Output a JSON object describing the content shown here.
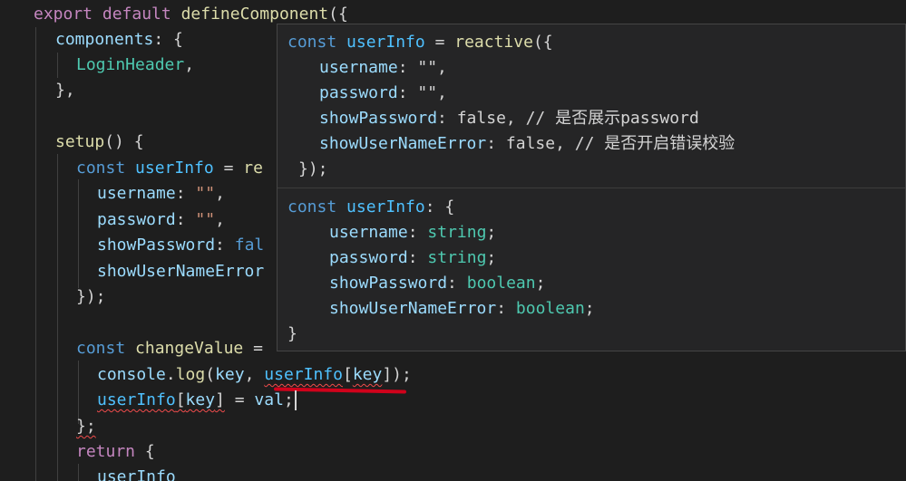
{
  "code": {
    "l1": {
      "kw1": "export",
      "kw2": "default",
      "fn": "defineComponent",
      "rest": "({"
    },
    "l2": {
      "key": "components",
      "rest": ": {"
    },
    "l3": {
      "cls": "LoginHeader",
      "rest": ","
    },
    "l4": {
      "rest": "},"
    },
    "l6": {
      "fn": "setup",
      "rest": "() {"
    },
    "l7": {
      "kw": "const",
      "var": "userInfo",
      "eq": " = ",
      "fn": "re"
    },
    "l8": {
      "key": "username",
      "colon": ": ",
      "str": "\"\"",
      "comma": ","
    },
    "l9": {
      "key": "password",
      "colon": ": ",
      "str": "\"\"",
      "comma": ","
    },
    "l10": {
      "key": "showPassword",
      "colon": ": ",
      "val": "fal"
    },
    "l11": {
      "key": "showUserNameError"
    },
    "l12": {
      "rest": "});"
    },
    "l14": {
      "kw": "const",
      "fn": "changeValue",
      "eq": " ="
    },
    "l15": {
      "obj": "console",
      "dot": ".",
      "fn": "log",
      "open": "(",
      "arg": "key",
      "sep": ", ",
      "var": "userInfo",
      "lb": "[",
      "key": "key",
      "rb": "]",
      "end": ");"
    },
    "l16": {
      "var": "userInfo",
      "lb": "[",
      "key": "key",
      "rb": "]",
      "eq": " = ",
      "val": "val",
      "end": ";"
    },
    "l17": {
      "rest": "};"
    },
    "l18": {
      "kw": "return",
      "rest": " {"
    },
    "l19": {
      "var": "userInfo"
    }
  },
  "hover": {
    "top": {
      "h1": {
        "kw": "const",
        "var": "userInfo",
        "eq": " = ",
        "fn": "reactive",
        "rest": "({"
      },
      "h2": {
        "key": "username",
        "rest": ": \"\","
      },
      "h3": {
        "key": "password",
        "rest": ": \"\","
      },
      "h4": {
        "key": "showPassword",
        "rest": ": false, // 是否展示password"
      },
      "h5": {
        "key": "showUserNameError",
        "rest": ": false, // 是否开启错误校验"
      },
      "h6": {
        "rest": "});"
      }
    },
    "bottom": {
      "b1": {
        "kw": "const",
        "var": "userInfo",
        "rest": ": {"
      },
      "b2": {
        "key": "username",
        "colon": ": ",
        "type": "string",
        "semi": ";"
      },
      "b3": {
        "key": "password",
        "colon": ": ",
        "type": "string",
        "semi": ";"
      },
      "b4": {
        "key": "showPassword",
        "colon": ": ",
        "type": "boolean",
        "semi": ";"
      },
      "b5": {
        "key": "showUserNameError",
        "colon": ": ",
        "type": "boolean",
        "semi": ";"
      },
      "b6": {
        "rest": "}"
      }
    }
  }
}
